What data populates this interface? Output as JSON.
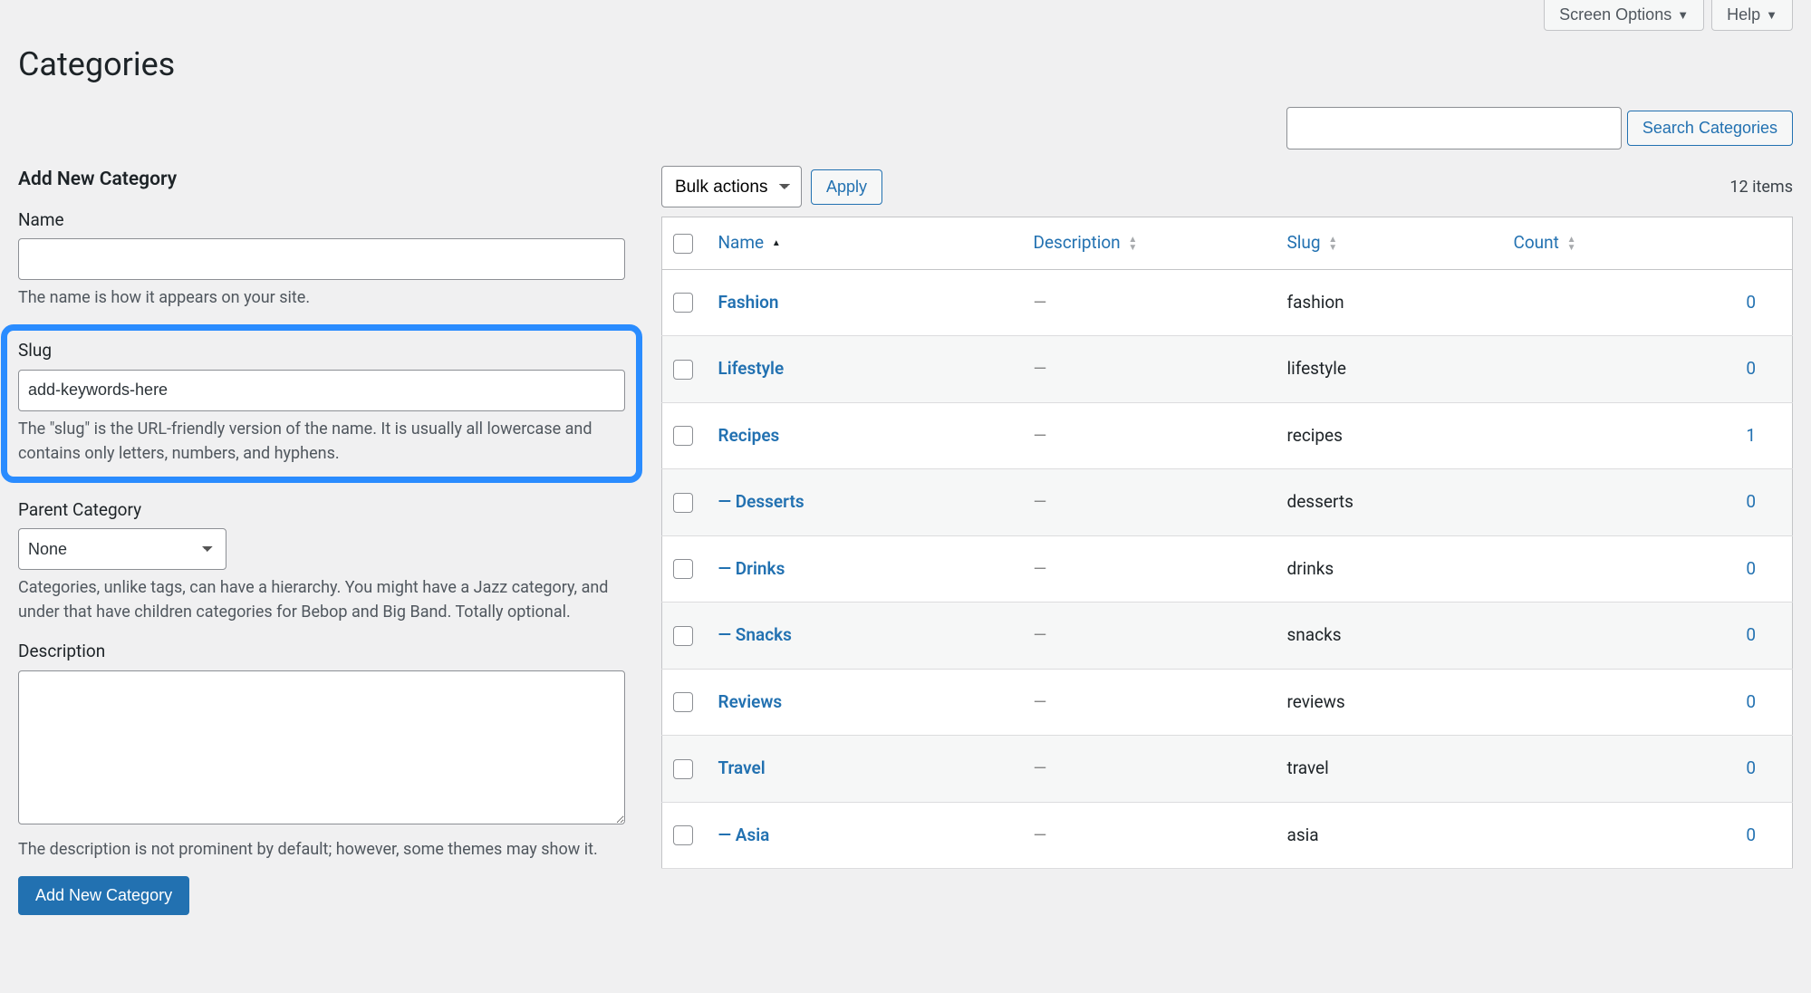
{
  "topbar": {
    "screen_options": "Screen Options",
    "help": "Help"
  },
  "page_title": "Categories",
  "search": {
    "button": "Search Categories"
  },
  "form": {
    "title": "Add New Category",
    "name_label": "Name",
    "name_help": "The name is how it appears on your site.",
    "slug_label": "Slug",
    "slug_value": "add-keywords-here",
    "slug_help": "The \"slug\" is the URL-friendly version of the name. It is usually all lowercase and contains only letters, numbers, and hyphens.",
    "parent_label": "Parent Category",
    "parent_value": "None",
    "parent_help": "Categories, unlike tags, can have a hierarchy. You might have a Jazz category, and under that have children categories for Bebop and Big Band. Totally optional.",
    "desc_label": "Description",
    "desc_help": "The description is not prominent by default; however, some themes may show it.",
    "submit": "Add New Category"
  },
  "bulk": {
    "label": "Bulk actions",
    "apply": "Apply",
    "items": "12 items"
  },
  "table": {
    "headers": {
      "name": "Name",
      "description": "Description",
      "slug": "Slug",
      "count": "Count"
    },
    "rows": [
      {
        "name": "Fashion",
        "description": "—",
        "slug": "fashion",
        "count": "0"
      },
      {
        "name": "Lifestyle",
        "description": "—",
        "slug": "lifestyle",
        "count": "0"
      },
      {
        "name": "Recipes",
        "description": "—",
        "slug": "recipes",
        "count": "1"
      },
      {
        "name": "— Desserts",
        "description": "—",
        "slug": "desserts",
        "count": "0"
      },
      {
        "name": "— Drinks",
        "description": "—",
        "slug": "drinks",
        "count": "0"
      },
      {
        "name": "— Snacks",
        "description": "—",
        "slug": "snacks",
        "count": "0"
      },
      {
        "name": "Reviews",
        "description": "—",
        "slug": "reviews",
        "count": "0"
      },
      {
        "name": "Travel",
        "description": "—",
        "slug": "travel",
        "count": "0"
      },
      {
        "name": "— Asia",
        "description": "—",
        "slug": "asia",
        "count": "0"
      }
    ]
  }
}
